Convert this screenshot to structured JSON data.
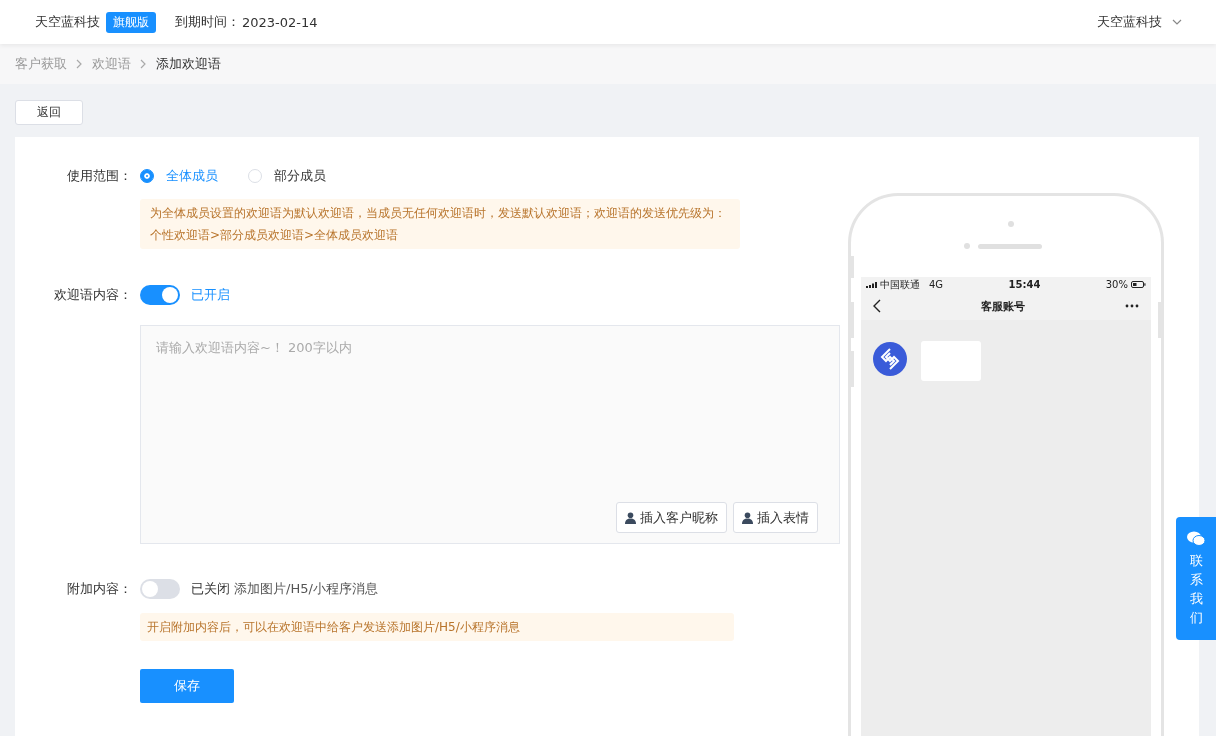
{
  "header": {
    "company": "天空蓝科技",
    "badge": "旗舰版",
    "expiry_label": "到期时间：",
    "expiry": "2023-02-14",
    "user": "天空蓝科技"
  },
  "breadcrumb": [
    {
      "label": "客户获取",
      "current": false
    },
    {
      "label": "欢迎语",
      "current": false
    },
    {
      "label": "添加欢迎语",
      "current": true
    }
  ],
  "back_button": "返回",
  "scope": {
    "label": "使用范围：",
    "options": [
      {
        "label": "全体成员",
        "selected": true
      },
      {
        "label": "部分成员",
        "selected": false
      }
    ],
    "note": "为全体成员设置的欢迎语为默认欢迎语，当成员无任何欢迎语时，发送默认欢迎语；欢迎语的发送优先级为：个性欢迎语>部分成员欢迎语>全体成员欢迎语"
  },
  "content": {
    "label": "欢迎语内容：",
    "on": true,
    "status": "已开启",
    "placeholder": "请输入欢迎语内容~！ 200字以内",
    "buttons": [
      "插入客户昵称",
      "插入表情"
    ]
  },
  "attachment": {
    "label": "附加内容：",
    "on": false,
    "status": "已关闭",
    "hint": "添加图片/H5/小程序消息",
    "note": "开启附加内容后，可以在欢迎语中给客户发送添加图片/H5/小程序消息"
  },
  "save_button": "保存",
  "phone": {
    "carrier": "中国联通",
    "network": "4G",
    "time": "15:44",
    "battery": "30%",
    "title": "客服账号"
  },
  "contact": "联系我们"
}
